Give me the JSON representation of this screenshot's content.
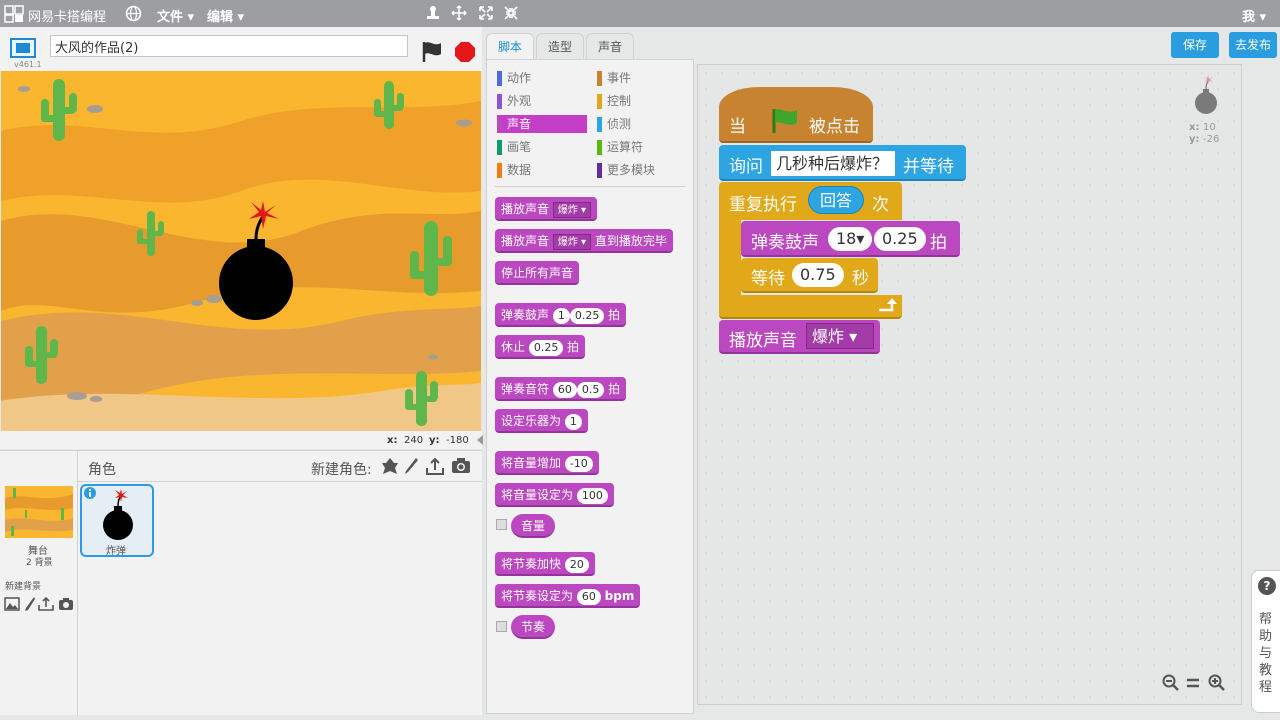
{
  "app": {
    "logo_text": "网易卡搭编程",
    "version": "v461.1"
  },
  "menu": {
    "file": "文件",
    "edit": "编辑",
    "user": "我"
  },
  "project": {
    "title": "大风的作品(2)"
  },
  "stage_coords": {
    "x_label": "x:",
    "x_value": "240",
    "y_label": "y:",
    "y_value": "-180"
  },
  "sprites_pane": {
    "title": "角色",
    "new_sprite_label": "新建角色:",
    "stage_label": "舞台",
    "stage_backdrops": "2 背景",
    "new_backdrop_label": "新建背景",
    "sprite_name": "炸弹"
  },
  "tabs": [
    "脚本",
    "造型",
    "声音"
  ],
  "actions": {
    "save": "保存",
    "publish": "去发布"
  },
  "categories": [
    {
      "label": "动作",
      "color": "#4a6cd4"
    },
    {
      "label": "事件",
      "color": "#c88330"
    },
    {
      "label": "外观",
      "color": "#8a55d7"
    },
    {
      "label": "控制",
      "color": "#e1a91a"
    },
    {
      "label": "声音",
      "color": "#bb48c0"
    },
    {
      "label": "侦测",
      "color": "#2ca5e2"
    },
    {
      "label": "画笔",
      "color": "#0e9a6c"
    },
    {
      "label": "运算符",
      "color": "#5cb712"
    },
    {
      "label": "数据",
      "color": "#ee7d16"
    },
    {
      "label": "更多模块",
      "color": "#632d99"
    }
  ],
  "palette": {
    "play_sound": "播放声音",
    "play_sound_until_done": "播放声音",
    "until_done": "直到播放完毕",
    "sound_option": "爆炸",
    "stop_all_sounds": "停止所有声音",
    "play_drum": "弹奏鼓声",
    "drum_val": "1",
    "beats_val": "0.25",
    "beats": "拍",
    "rest": "休止",
    "rest_val": "0.25",
    "play_note": "弹奏音符",
    "note_val": "60",
    "note_beats": "0.5",
    "set_instrument": "设定乐器为",
    "instrument_val": "1",
    "change_volume": "将音量增加",
    "change_volume_val": "-10",
    "set_volume": "将音量设定为",
    "set_volume_val": "100",
    "volume": "音量",
    "change_tempo": "将节奏加快",
    "change_tempo_val": "20",
    "set_tempo": "将节奏设定为",
    "set_tempo_val": "60",
    "bpm": "bpm",
    "tempo": "节奏"
  },
  "script": {
    "when": "当",
    "clicked": "被点击",
    "ask": "询问",
    "ask_text": "几秒种后爆炸？",
    "and_wait": "并等待",
    "repeat": "重复执行",
    "answer": "回答",
    "times": "次",
    "drum": "弹奏鼓声",
    "drum_val": "18",
    "drum_beats": "0.25",
    "beat": "拍",
    "wait": "等待",
    "wait_val": "0.75",
    "seconds": "秒",
    "play_sound": "播放声音",
    "sound_val": "爆炸"
  },
  "sprite_info": {
    "x_label": "x:",
    "x_value": "10",
    "y_label": "y:",
    "y_value": "-26"
  },
  "help": {
    "label": "帮助与教程",
    "q": "?"
  }
}
